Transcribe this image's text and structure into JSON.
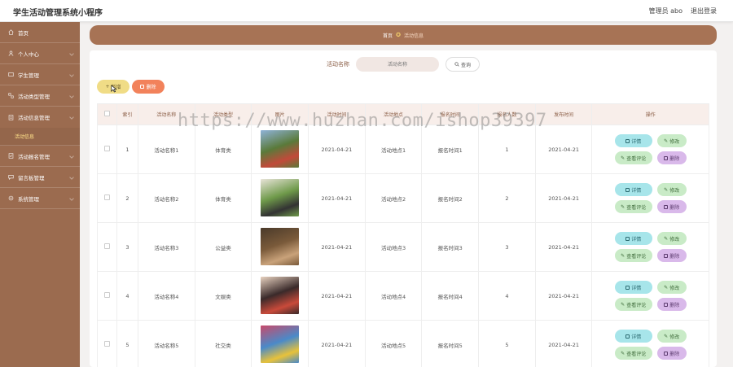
{
  "header": {
    "app_title": "学生活动管理系统小程序",
    "admin_label": "管理员 abo",
    "logout_label": "退出登录"
  },
  "sidebar": {
    "items": [
      {
        "label": "首页",
        "icon": "home-icon"
      },
      {
        "label": "个人中心",
        "icon": "user-icon"
      },
      {
        "label": "学生管理",
        "icon": "student-icon"
      },
      {
        "label": "活动类型管理",
        "icon": "category-icon"
      },
      {
        "label": "活动信息管理",
        "icon": "info-icon",
        "sub": "活动信息"
      },
      {
        "label": "活动报名管理",
        "icon": "signup-icon"
      },
      {
        "label": "留言板管理",
        "icon": "message-icon"
      },
      {
        "label": "系统管理",
        "icon": "system-icon"
      }
    ]
  },
  "breadcrumb": {
    "home": "首页",
    "current": "活动信息"
  },
  "search": {
    "label": "活动名称",
    "placeholder": "活动名称",
    "button_label": "查询"
  },
  "toolbar": {
    "add_label": "新增",
    "delete_label": "删除"
  },
  "table": {
    "headers": [
      "索引",
      "活动名称",
      "活动类型",
      "图片",
      "活动时间",
      "活动地点",
      "报名时间",
      "报名人数",
      "发布时间",
      "操作"
    ],
    "rows": [
      {
        "index": "1",
        "name": "活动名称1",
        "type": "体育类",
        "time": "2021-04-21",
        "place": "活动地点1",
        "signup_time": "报名时间1",
        "count": "1",
        "publish": "2021-04-21"
      },
      {
        "index": "2",
        "name": "活动名称2",
        "type": "体育类",
        "time": "2021-04-21",
        "place": "活动地点2",
        "signup_time": "报名时间2",
        "count": "2",
        "publish": "2021-04-21"
      },
      {
        "index": "3",
        "name": "活动名称3",
        "type": "公益类",
        "time": "2021-04-21",
        "place": "活动地点3",
        "signup_time": "报名时间3",
        "count": "3",
        "publish": "2021-04-21"
      },
      {
        "index": "4",
        "name": "活动名称4",
        "type": "文娱类",
        "time": "2021-04-21",
        "place": "活动地点4",
        "signup_time": "报名时间4",
        "count": "4",
        "publish": "2021-04-21"
      },
      {
        "index": "5",
        "name": "活动名称5",
        "type": "社交类",
        "time": "2021-04-21",
        "place": "活动地点5",
        "signup_time": "报名时间5",
        "count": "5",
        "publish": "2021-04-21"
      }
    ],
    "actions": {
      "detail": "详情",
      "edit": "修改",
      "comment": "查看评论",
      "delete": "删除"
    }
  },
  "watermark": "https://www.huzhan.com/ishop39397",
  "colors": {
    "sidebar": "#9b6b4f",
    "breadcrumb": "#a77355",
    "add": "#f0dc86",
    "delete": "#f2825b"
  }
}
